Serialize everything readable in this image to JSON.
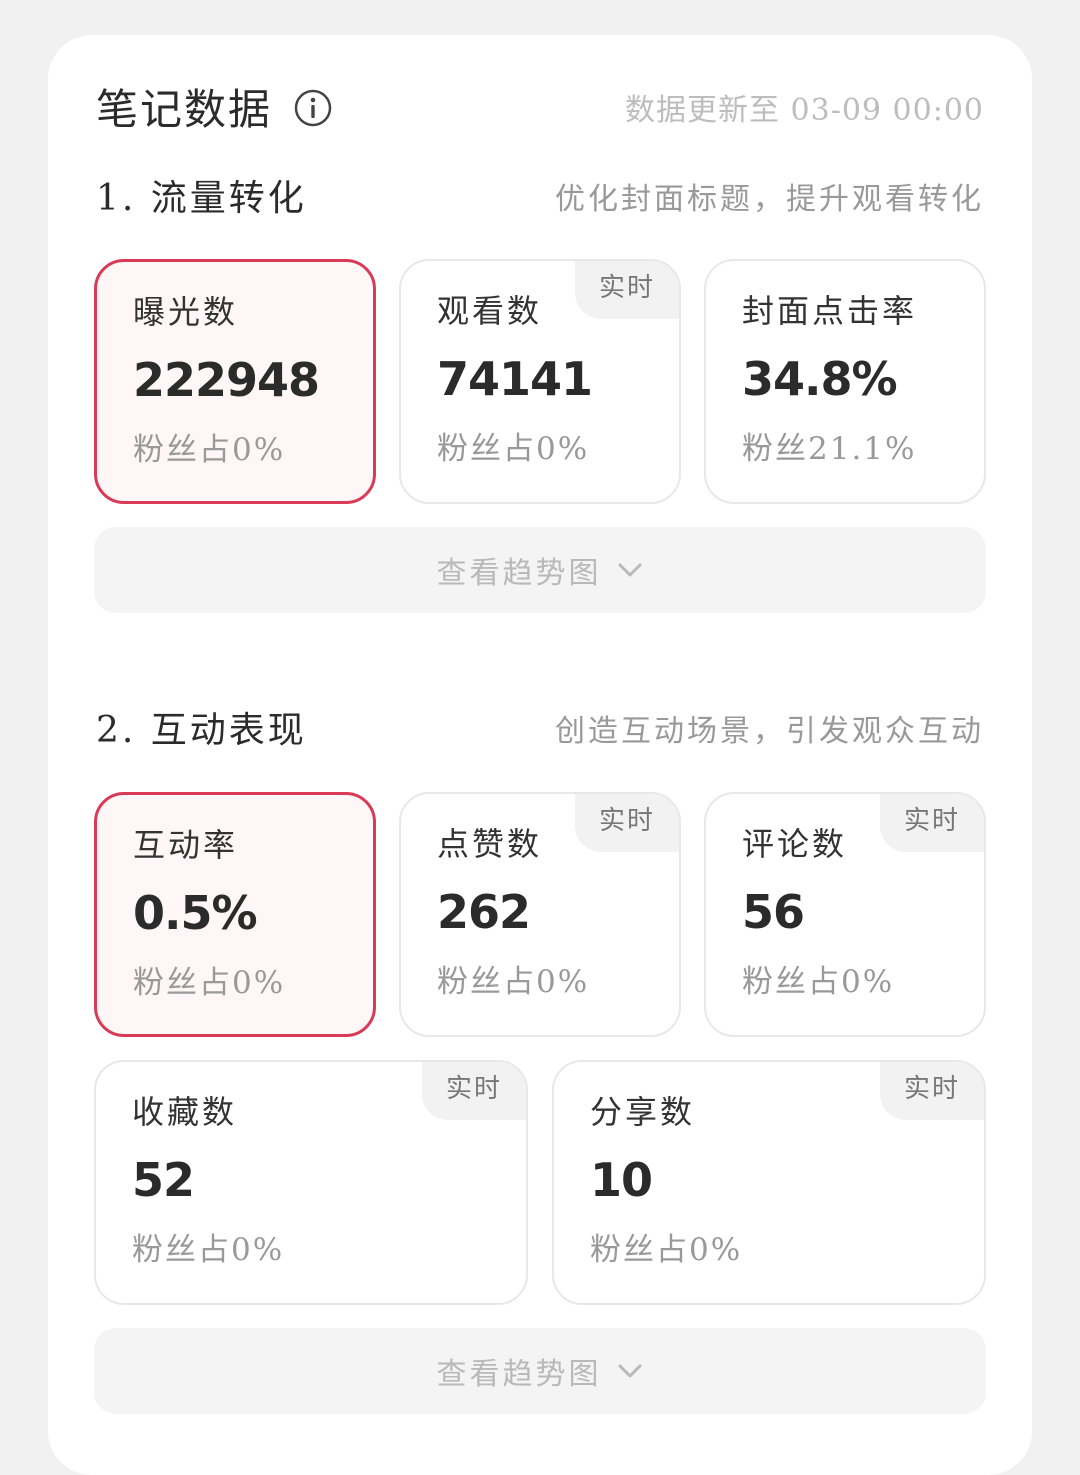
{
  "header": {
    "title": "笔记数据",
    "info_icon": "info-icon",
    "update_text": "数据更新至 03-09 00:00"
  },
  "sections": [
    {
      "title": "1. 流量转化",
      "hint": "优化封面标题，提升观看转化",
      "metrics": [
        {
          "label": "曝光数",
          "value": "222948",
          "sub": "粉丝占0%",
          "badge": ""
        },
        {
          "label": "观看数",
          "value": "74141",
          "sub": "粉丝占0%",
          "badge": "实时"
        },
        {
          "label": "封面点击率",
          "value": "34.8%",
          "sub": "粉丝21.1%",
          "badge": ""
        }
      ],
      "trend_label": "查看趋势图"
    },
    {
      "title": "2. 互动表现",
      "hint": "创造互动场景，引发观众互动",
      "metrics": [
        {
          "label": "互动率",
          "value": "0.5%",
          "sub": "粉丝占0%",
          "badge": ""
        },
        {
          "label": "点赞数",
          "value": "262",
          "sub": "粉丝占0%",
          "badge": "实时"
        },
        {
          "label": "评论数",
          "value": "56",
          "sub": "粉丝占0%",
          "badge": "实时"
        },
        {
          "label": "收藏数",
          "value": "52",
          "sub": "粉丝占0%",
          "badge": "实时"
        },
        {
          "label": "分享数",
          "value": "10",
          "sub": "粉丝占0%",
          "badge": "实时"
        }
      ],
      "trend_label": "查看趋势图"
    }
  ],
  "colors": {
    "accent_border": "#d93b57",
    "active_bg": "#fff7f7",
    "page_bg": "#f1f1f1"
  }
}
